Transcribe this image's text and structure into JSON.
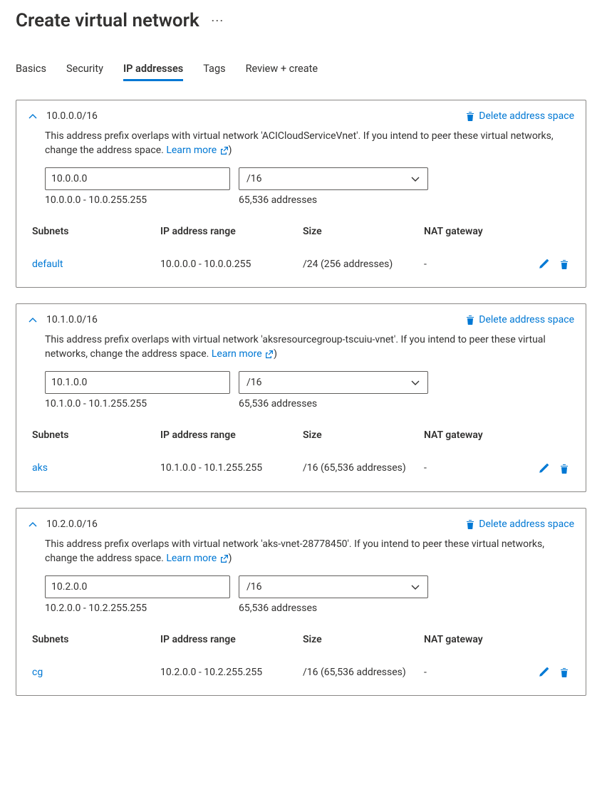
{
  "page_title": "Create virtual network",
  "tabs": [
    "Basics",
    "Security",
    "IP addresses",
    "Tags",
    "Review + create"
  ],
  "active_tab": 2,
  "delete_label": "Delete address space",
  "learn_more_label": "Learn more",
  "subnet_headers": {
    "subnets": "Subnets",
    "range": "IP address range",
    "size": "Size",
    "nat": "NAT gateway"
  },
  "spaces": [
    {
      "cidr_title": "10.0.0.0/16",
      "overlap_msg": "This address prefix overlaps with virtual network 'ACICloudServiceVnet'. If you intend to peer these virtual networks, change the address space.  ",
      "prefix_value": "10.0.0.0",
      "cidr_value": "/16",
      "range_text": "10.0.0.0 - 10.0.255.255",
      "count_text": "65,536 addresses",
      "subnets": [
        {
          "name": "default",
          "range": "10.0.0.0 - 10.0.0.255",
          "size": "/24 (256 addresses)",
          "nat": "-"
        }
      ]
    },
    {
      "cidr_title": "10.1.0.0/16",
      "overlap_msg": "This address prefix overlaps with virtual network 'aksresourcegroup-tscuiu-vnet'. If you intend to peer these virtual networks, change the address space.  ",
      "prefix_value": "10.1.0.0",
      "cidr_value": "/16",
      "range_text": "10.1.0.0 - 10.1.255.255",
      "count_text": "65,536 addresses",
      "subnets": [
        {
          "name": "aks",
          "range": "10.1.0.0 - 10.1.255.255",
          "size": "/16 (65,536 addresses)",
          "nat": "-"
        }
      ]
    },
    {
      "cidr_title": "10.2.0.0/16",
      "overlap_msg": "This address prefix overlaps with virtual network 'aks-vnet-28778450'. If you intend to peer these virtual networks, change the address space.  ",
      "prefix_value": "10.2.0.0",
      "cidr_value": "/16",
      "range_text": "10.2.0.0 - 10.2.255.255",
      "count_text": "65,536 addresses",
      "subnets": [
        {
          "name": "cg",
          "range": "10.2.0.0 - 10.2.255.255",
          "size": "/16 (65,536 addresses)",
          "nat": "-"
        }
      ]
    }
  ]
}
